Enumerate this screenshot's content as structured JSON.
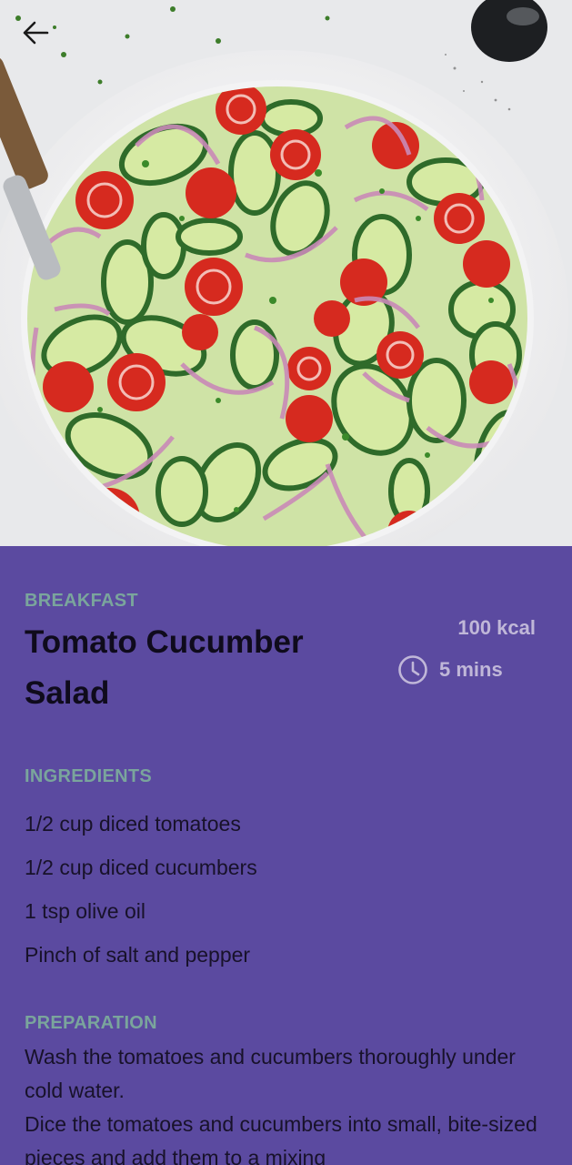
{
  "header": {
    "back_icon": "arrow-left-icon"
  },
  "hero": {
    "image_description": "salad-bowl-photo"
  },
  "recipe": {
    "category": "BREAKFAST",
    "title": "Tomato Cucumber Salad",
    "calories": "100 kcal",
    "time_icon": "clock-icon",
    "time": "5 mins"
  },
  "ingredients": {
    "heading": "INGREDIENTS",
    "items": [
      "1/2 cup diced tomatoes",
      "1/2 cup diced cucumbers",
      "1 tsp olive oil",
      "Pinch of salt and pepper"
    ]
  },
  "preparation": {
    "heading": "PREPARATION",
    "steps": [
      "Wash the tomatoes and cucumbers thoroughly under cold water.",
      "Dice the tomatoes and cucumbers into small, bite-sized pieces and add them to a mixing"
    ]
  },
  "colors": {
    "panel_background": "#5b4aa0",
    "section_heading": "#7aa59c",
    "meta_text": "#c0b7d8",
    "body_text": "#18122a"
  }
}
